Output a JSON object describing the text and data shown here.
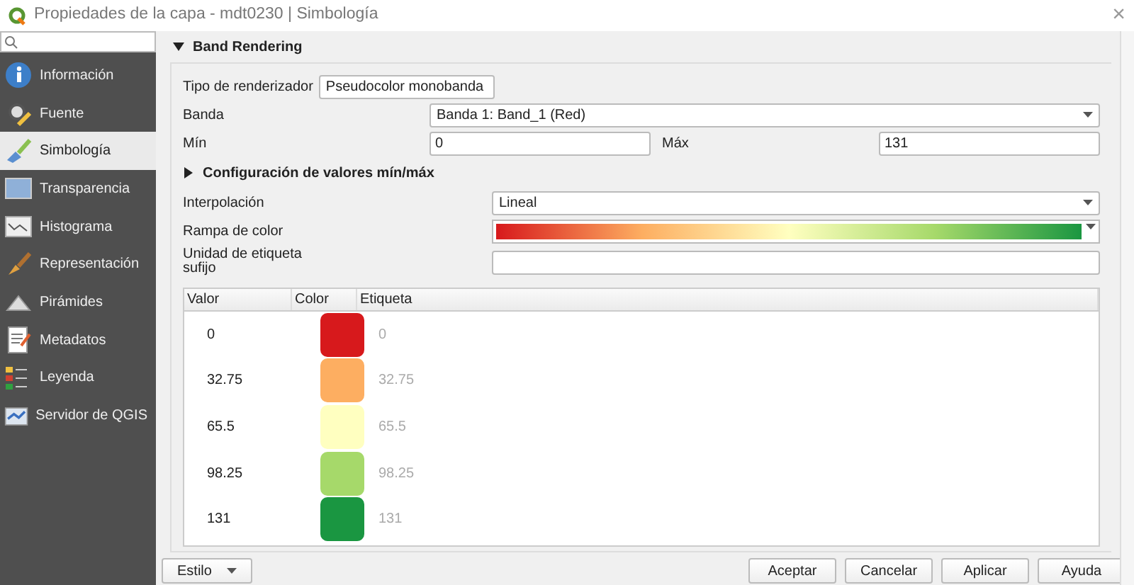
{
  "window": {
    "title": "Propiedades de la capa - mdt0230 | Simbología",
    "close": "×"
  },
  "sidebar": {
    "items": [
      {
        "label": "Información",
        "selected": false
      },
      {
        "label": "Fuente",
        "selected": false
      },
      {
        "label": "Simbología",
        "selected": true
      },
      {
        "label": "Transparencia",
        "selected": false
      },
      {
        "label": "Histograma",
        "selected": false
      },
      {
        "label": "Representación",
        "selected": false
      },
      {
        "label": "Pirámides",
        "selected": false
      },
      {
        "label": "Metadatos",
        "selected": false
      },
      {
        "label": "Leyenda",
        "selected": false
      },
      {
        "label": "Servidor de QGIS",
        "selected": false
      }
    ]
  },
  "section": {
    "title": "Band Rendering",
    "expanded": true
  },
  "renderer": {
    "label": "Tipo de renderizador",
    "value": "Pseudocolor monobanda"
  },
  "band": {
    "label": "Banda",
    "value": "Banda 1: Band_1 (Red)"
  },
  "min": {
    "label": "Mín",
    "value": "0"
  },
  "max": {
    "label": "Máx",
    "value": "131"
  },
  "minmax_settings": {
    "title": "Configuración de valores mín/máx",
    "expanded": false
  },
  "interpolation": {
    "label": "Interpolación",
    "value": "Lineal"
  },
  "color_ramp": {
    "label": "Rampa de color"
  },
  "label_unit": {
    "label": "Unidad de etiqueta\nsufijo"
  },
  "table": {
    "columns": [
      "Valor",
      "Color",
      "Etiqueta"
    ],
    "rows": [
      {
        "value": "0",
        "color": "#d7191c",
        "label": "0"
      },
      {
        "value": "32.75",
        "color": "#fdae61",
        "label": "32.75"
      },
      {
        "value": "65.5",
        "color": "#ffffc0",
        "label": "65.5"
      },
      {
        "value": "98.25",
        "color": "#a6d96a",
        "label": "98.25"
      },
      {
        "value": "131",
        "color": "#1a9641",
        "label": "131"
      }
    ]
  },
  "style_button": "Estilo",
  "buttons": [
    "Aceptar",
    "Cancelar",
    "Aplicar",
    "Ayuda"
  ]
}
